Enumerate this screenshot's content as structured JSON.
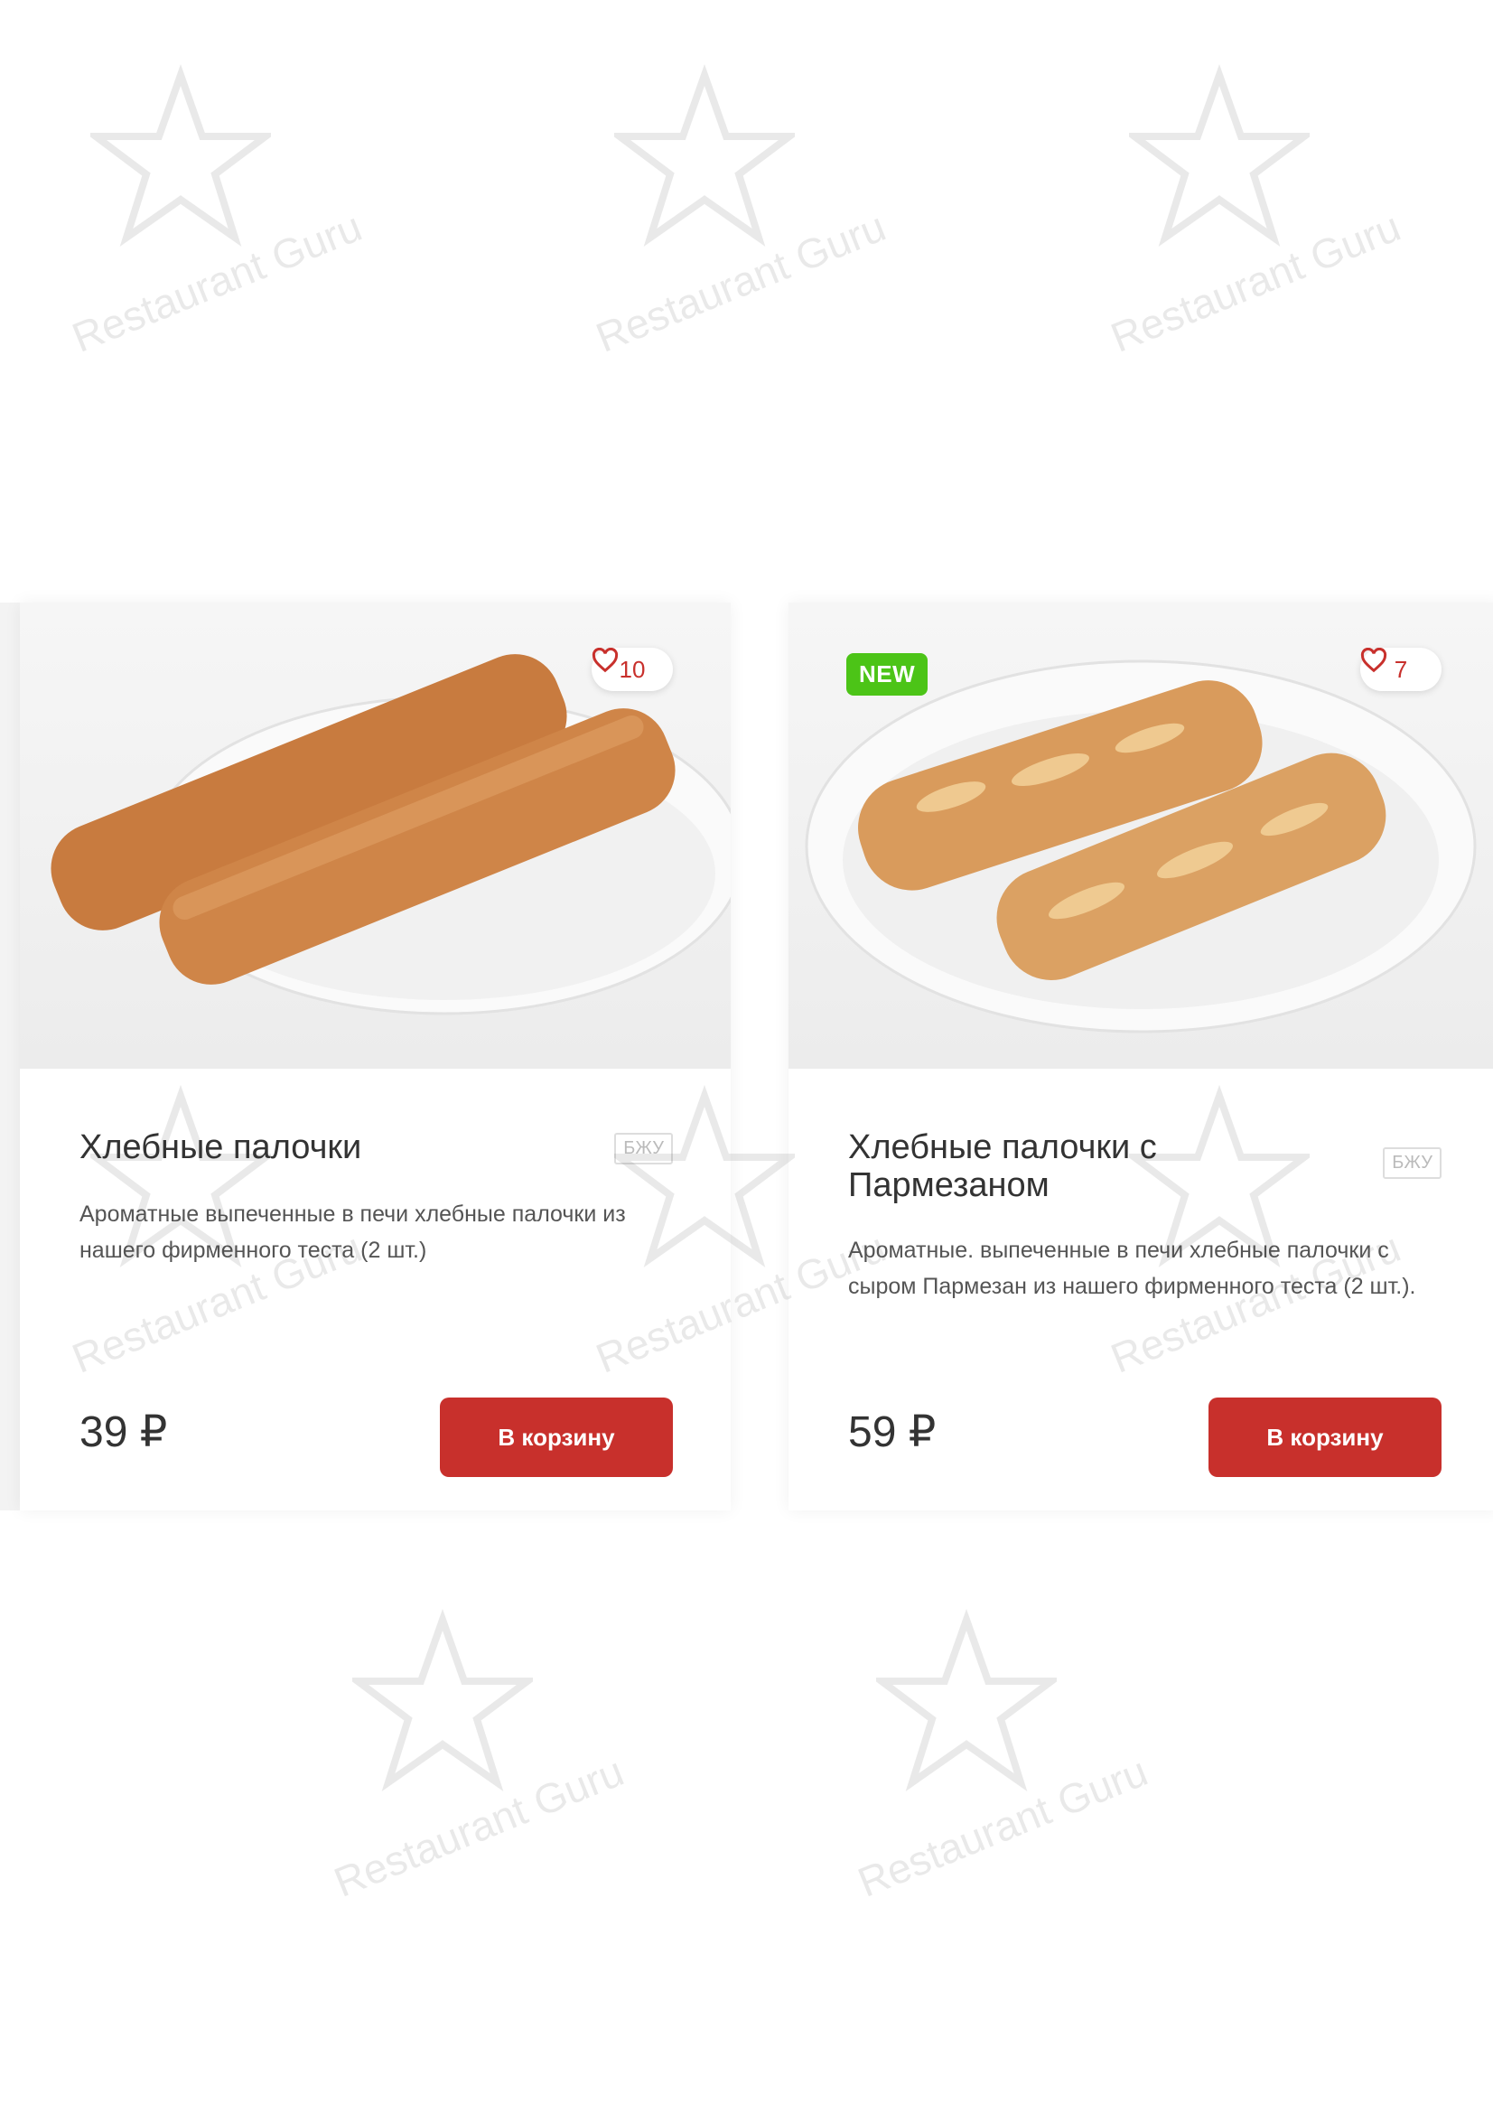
{
  "watermark": {
    "text": "Restaurant Guru",
    "icon": "star-fork-icon"
  },
  "products": [
    {
      "title": "Хлебные палочки",
      "description": "Ароматные выпеченные в печи хлебные палочки из нашего фирменного теста (2 шт.)",
      "likes": "10",
      "bju_label": "БЖУ",
      "price": "39 ₽",
      "buy_label": "В корзину",
      "badge": ""
    },
    {
      "title": "Хлебные палочки с Пармезаном",
      "description": "Ароматные. выпеченные в печи хлебные палочки с сыром Пармезан из нашего фирменного теста (2 шт.).",
      "likes": "7",
      "bju_label": "БЖУ",
      "price": "59 ₽",
      "buy_label": "В корзину",
      "badge": "NEW"
    }
  ],
  "colors": {
    "accent": "#c8302c",
    "new_badge": "#4cc417",
    "text": "#333333"
  }
}
